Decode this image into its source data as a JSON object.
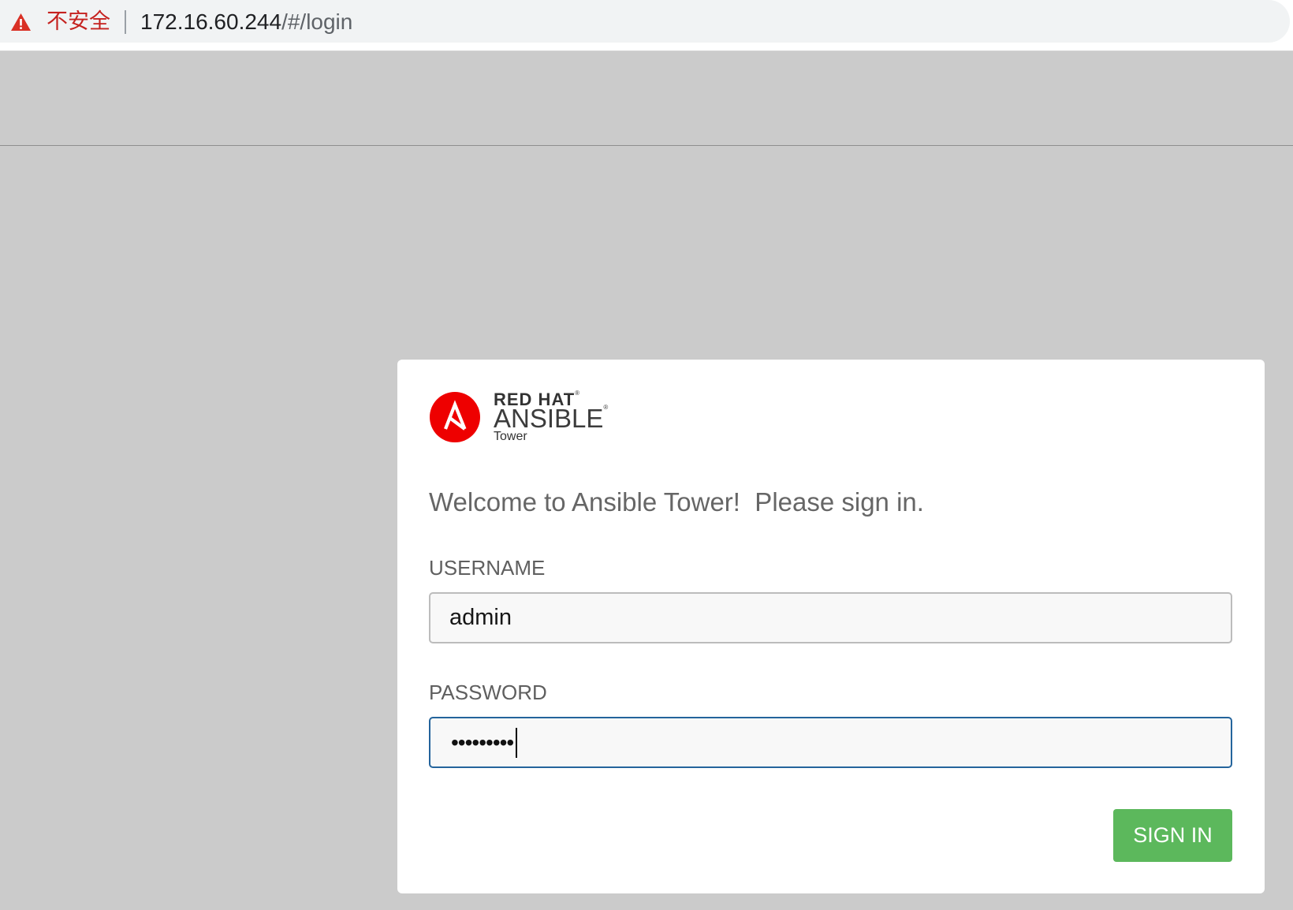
{
  "browser": {
    "security_icon": "warning-triangle-icon",
    "security_label": "不安全",
    "url": {
      "host": "172.16.60.244",
      "path": "/#/login"
    }
  },
  "brand": {
    "logo_icon": "ansible-logo-icon",
    "company": "RED HAT",
    "product": "ANSIBLE",
    "edition": "Tower",
    "registered_mark": "®",
    "logo_color": "#ee0000"
  },
  "login": {
    "welcome": "Welcome to Ansible Tower!  Please sign in.",
    "username": {
      "label": "USERNAME",
      "value": "admin"
    },
    "password": {
      "label": "PASSWORD",
      "masked_value": "•••••••••"
    },
    "submit_label": "SIGN IN"
  },
  "colors": {
    "page_background": "#cbcbcb",
    "warning": "#c5221f",
    "focus_border": "#24649c",
    "primary_button": "#5cb85c"
  }
}
